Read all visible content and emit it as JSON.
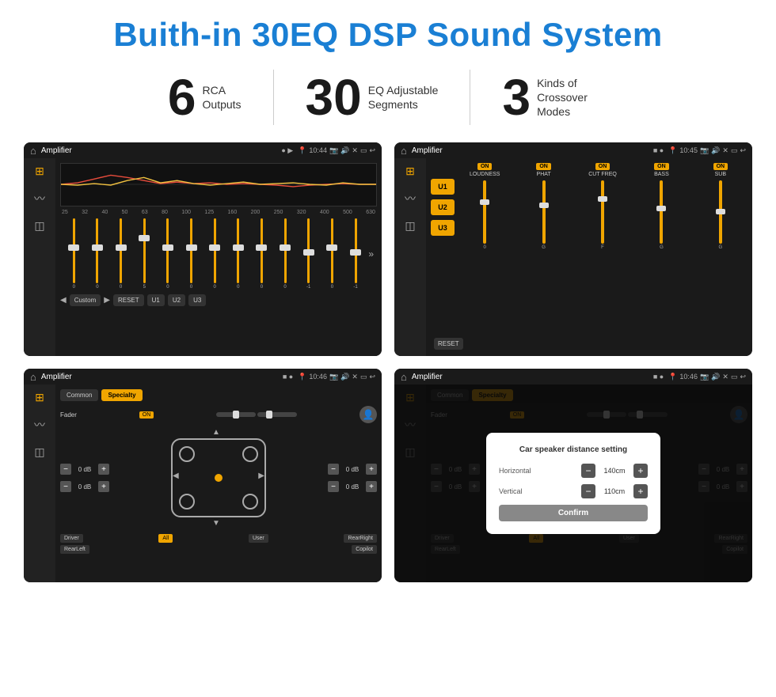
{
  "title": "Buith-in 30EQ DSP Sound System",
  "stats": [
    {
      "number": "6",
      "label_top": "RCA",
      "label_bottom": "Outputs"
    },
    {
      "number": "30",
      "label_top": "EQ Adjustable",
      "label_bottom": "Segments"
    },
    {
      "number": "3",
      "label_top": "Kinds of",
      "label_bottom": "Crossover Modes"
    }
  ],
  "screens": {
    "eq": {
      "title": "Amplifier",
      "time": "10:44",
      "freq_labels": [
        "25",
        "32",
        "40",
        "50",
        "63",
        "80",
        "100",
        "125",
        "160",
        "200",
        "250",
        "320",
        "400",
        "500",
        "630"
      ],
      "slider_values": [
        "0",
        "0",
        "0",
        "5",
        "0",
        "0",
        "0",
        "0",
        "0",
        "0",
        "-1",
        "0",
        "-1"
      ],
      "buttons": [
        "Custom",
        "RESET",
        "U1",
        "U2",
        "U3"
      ]
    },
    "crossover": {
      "title": "Amplifier",
      "time": "10:45",
      "u_buttons": [
        "U1",
        "U2",
        "U3"
      ],
      "sections": [
        "LOUDNESS",
        "PHAT",
        "CUT FREQ",
        "BASS",
        "SUB"
      ],
      "reset_label": "RESET"
    },
    "fader": {
      "title": "Amplifier",
      "time": "10:46",
      "tabs": [
        "Common",
        "Specialty"
      ],
      "fader_label": "Fader",
      "on_label": "ON",
      "db_values_left": [
        "0 dB",
        "0 dB"
      ],
      "db_values_right": [
        "0 dB",
        "0 dB"
      ],
      "bottom_labels": [
        "Driver",
        "All",
        "User",
        "RearRight",
        "RearLeft",
        "Copilot"
      ]
    },
    "dialog": {
      "title": "Amplifier",
      "time": "10:46",
      "dialog_title": "Car speaker distance setting",
      "horizontal_label": "Horizontal",
      "horizontal_value": "140cm",
      "vertical_label": "Vertical",
      "vertical_value": "110cm",
      "confirm_label": "Confirm",
      "db_right_top": "0 dB",
      "db_right_bottom": "0 dB"
    }
  }
}
